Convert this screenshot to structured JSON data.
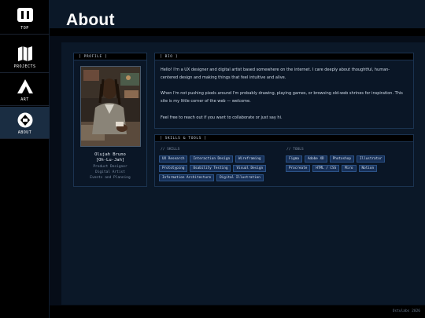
{
  "nav": [
    {
      "label": "TOP",
      "icon": "top-icon"
    },
    {
      "label": "PROJECTS",
      "icon": "projects-icon"
    },
    {
      "label": "ART",
      "icon": "art-icon"
    },
    {
      "label": "ABOUT",
      "icon": "about-icon",
      "active": true
    }
  ],
  "page": {
    "title": "About"
  },
  "profile": {
    "header": "[ PROFILE ]",
    "name": "Olujah Bruno",
    "pronunciation": "[Oh-Lu-Jah]",
    "roles": [
      "Product Designer",
      "Digital Artist",
      "Events and Planning"
    ]
  },
  "bio": {
    "header": "[ BIO ]",
    "paragraphs": [
      "Hello! I'm a UX designer and digital artist based somewhere on the internet. I care deeply about thoughtful, human-centered design and making things that feel intuitive and alive.",
      "When I'm not pushing pixels around I'm probably drawing, playing games, or browsing old-web shrines for inspiration. This site is my little corner of the web — welcome.",
      "Feel free to reach out if you want to collaborate or just say hi."
    ]
  },
  "skills_tools": {
    "header": "[ SKILLS & TOOLS ]",
    "skills_label": "// SKILLS",
    "tools_label": "// TOOLS",
    "skills": [
      "UX Research",
      "Interaction Design",
      "Wireframing",
      "Prototyping",
      "Usability Testing",
      "Visual Design",
      "Information Architecture",
      "Digital Illustration"
    ],
    "tools": [
      "Figma",
      "Adobe XD",
      "Photoshop",
      "Illustrator",
      "Procreate",
      "HTML / CSS",
      "Miro",
      "Notion"
    ]
  },
  "footer": {
    "copyright": "Ostulabs 2026"
  },
  "colors": {
    "accent": "#1a2d42",
    "tag_bg": "#173057",
    "tag_border": "#2b5286",
    "background": "#060d18"
  }
}
